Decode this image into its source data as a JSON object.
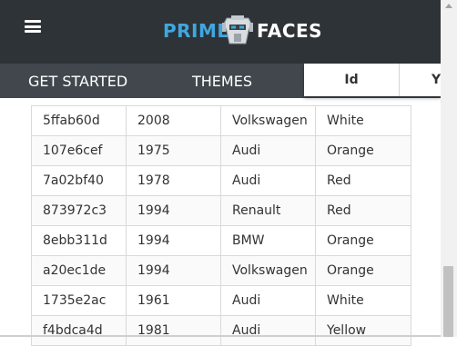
{
  "header": {
    "logo_prime": "PRIME",
    "logo_faces": "FACES"
  },
  "nav": {
    "items": [
      "GET STARTED",
      "THEMES"
    ]
  },
  "table": {
    "visible_columns": [
      "Id",
      "Y"
    ],
    "rows": [
      [
        "5ffab60d",
        "2008",
        "Volkswagen",
        "White"
      ],
      [
        "107e6cef",
        "1975",
        "Audi",
        "Orange"
      ],
      [
        "7a02bf40",
        "1978",
        "Audi",
        "Red"
      ],
      [
        "873972c3",
        "1994",
        "Renault",
        "Red"
      ],
      [
        "8ebb311d",
        "1994",
        "BMW",
        "Orange"
      ],
      [
        "a20ec1de",
        "1994",
        "Volkswagen",
        "Orange"
      ],
      [
        "1735e2ac",
        "1961",
        "Audi",
        "White"
      ],
      [
        "f4bdca4d",
        "1981",
        "Audi",
        "Yellow"
      ]
    ]
  },
  "colors": {
    "topbar": "#2e3338",
    "navbar": "#41474d",
    "brand_blue": "#3fa7e0"
  },
  "icons": {
    "menu": "hamburger-icon",
    "logo": "robot-icon"
  }
}
